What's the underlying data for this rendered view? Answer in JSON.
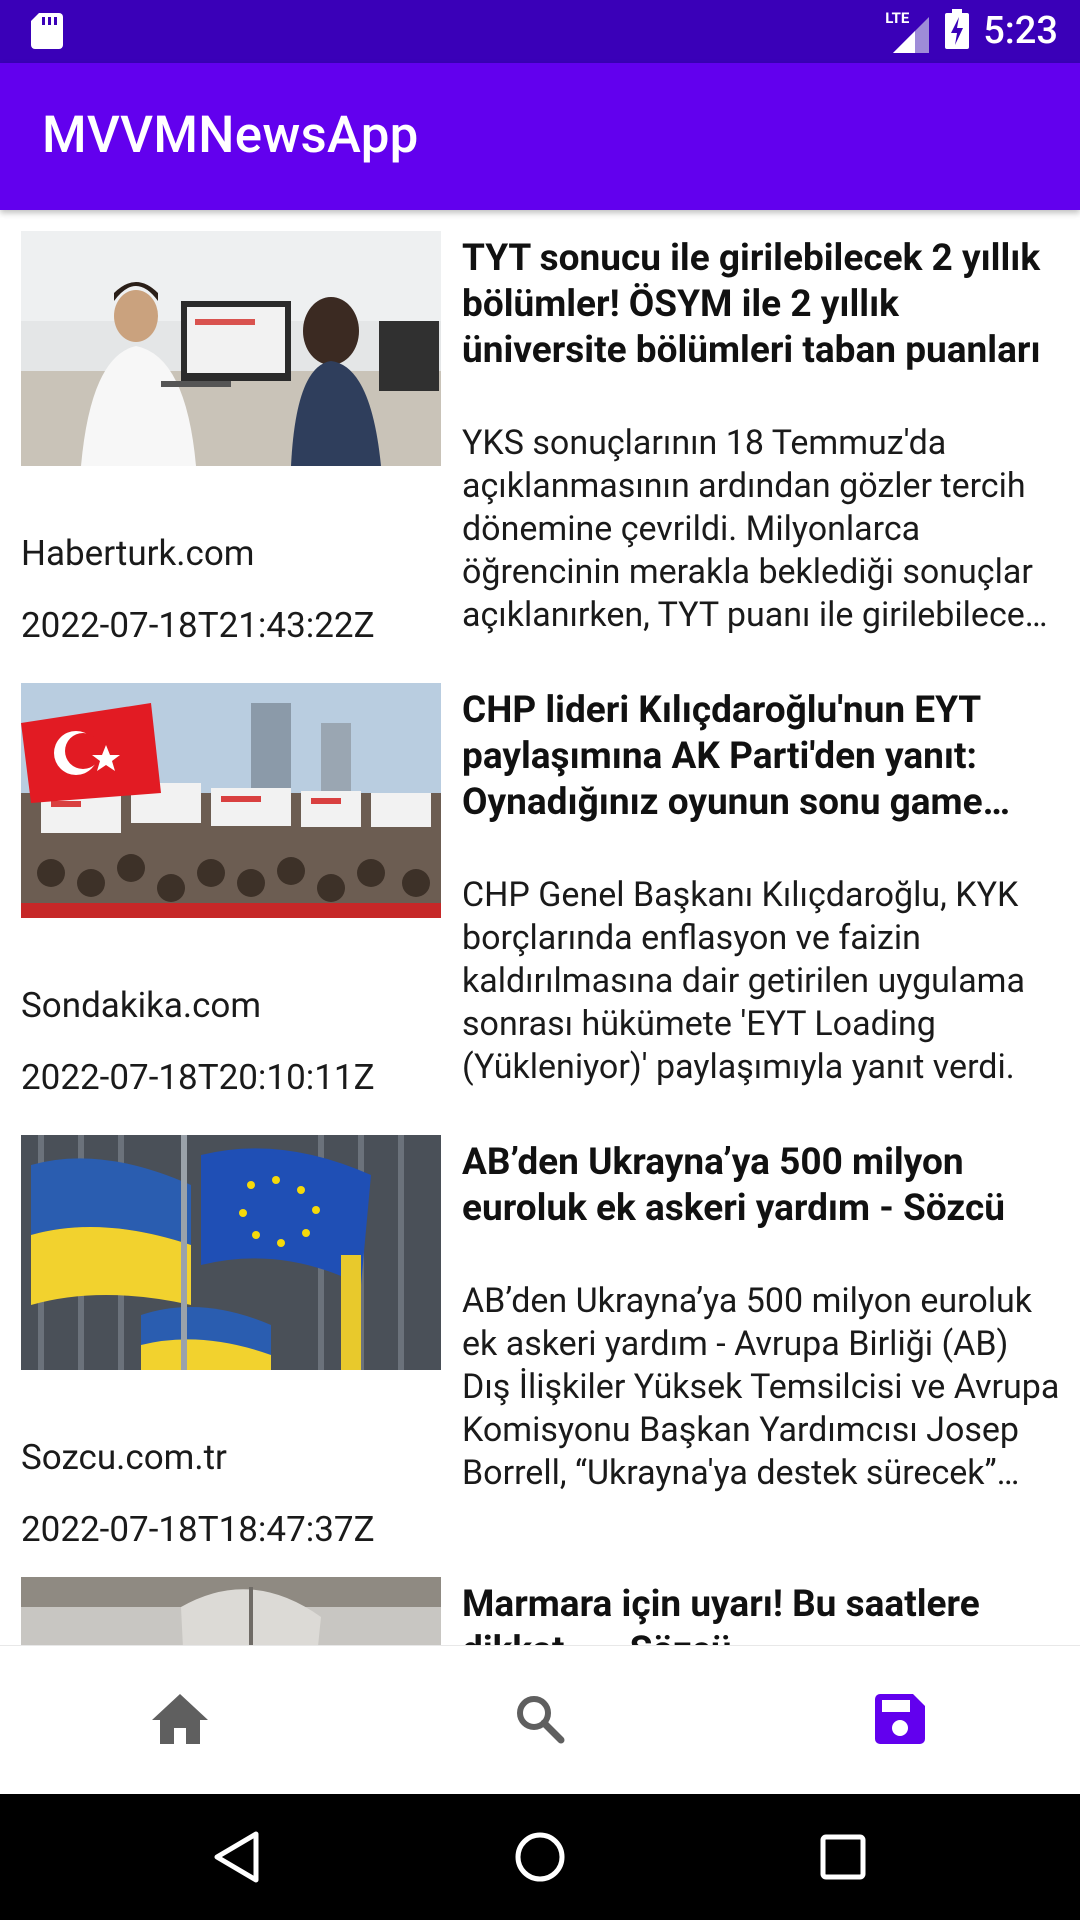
{
  "status_bar": {
    "time": "5:23",
    "network_label": "LTE",
    "icons": [
      "sd-card-icon",
      "lte-signal-icon",
      "battery-charging-icon"
    ]
  },
  "app_bar": {
    "title": "MVVMNewsApp"
  },
  "articles": [
    {
      "title": "TYT sonucu ile girilebilecek 2 yıllık bölümler! ÖSYM ile 2 yıllık üniversite bölümleri taban puanları",
      "description": "YKS sonuçlarının 18 Temmuz'da açıklanmasının ardından gözler tercih dönemine çevrildi. Milyonlarca öğrencinin merakla beklediği sonuçlar açıklanırken, TYT puanı ile girilebilecek bölümler araştırılıyor.",
      "source": "Haberturk.com",
      "published_at": "2022-07-18T21:43:22Z"
    },
    {
      "title": "CHP lideri Kılıçdaroğlu'nun EYT paylaşımına AK Parti'den yanıt: Oynadığınız oyunun sonu game over",
      "description": "CHP Genel Başkanı Kılıçdaroğlu, KYK borçlarında enflasyon ve faizin kaldırılmasına dair getirilen uygulama sonrası hükümete 'EYT Loading (Yükleniyor)' paylaşımıyla yanıt verdi.",
      "source": "Sondakika.com",
      "published_at": "2022-07-18T20:10:11Z"
    },
    {
      "title": "AB’den Ukrayna’ya 500 milyon euroluk ek askeri yardım - Sözcü",
      "description": "AB’den Ukrayna’ya 500 milyon euroluk ek askeri yardım - Avrupa Birliği (AB) Dış İlişkiler Yüksek Temsilcisi ve Avrupa Komisyonu Başkan Yardımcısı Josep Borrell, “Ukrayna'ya destek sürecek” dedi.",
      "source": "Sozcu.com.tr",
      "published_at": "2022-07-18T18:47:37Z"
    },
    {
      "title": "Marmara için uyarı! Bu saatlere dikkat... - Sözcü",
      "description": "",
      "source": "",
      "published_at": ""
    }
  ],
  "bottom_nav": {
    "items": [
      {
        "icon": "home-icon",
        "selected": false
      },
      {
        "icon": "search-icon",
        "selected": false
      },
      {
        "icon": "save-icon",
        "selected": true
      }
    ],
    "active_color": "#6200ee",
    "inactive_color": "#5f5f5f"
  },
  "colors": {
    "status_bar": "#3a00b8",
    "app_bar": "#6200ee"
  }
}
